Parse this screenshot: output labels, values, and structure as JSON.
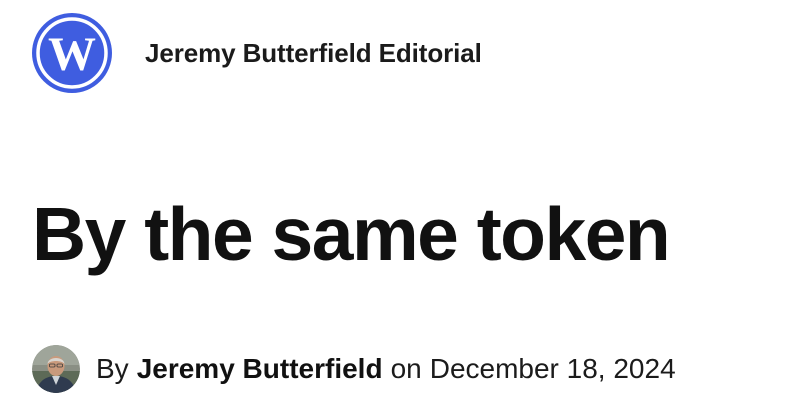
{
  "header": {
    "logo_icon": "wordpress-logo-icon",
    "site_title": "Jeremy Butterfield Editorial",
    "brand_color": "#3f5de0"
  },
  "post": {
    "title": "By the same token"
  },
  "byline": {
    "avatar_icon": "author-avatar",
    "by_prefix": "By",
    "author_name": "Jeremy Butterfield",
    "on_word": "on",
    "date": "December 18, 2024"
  }
}
